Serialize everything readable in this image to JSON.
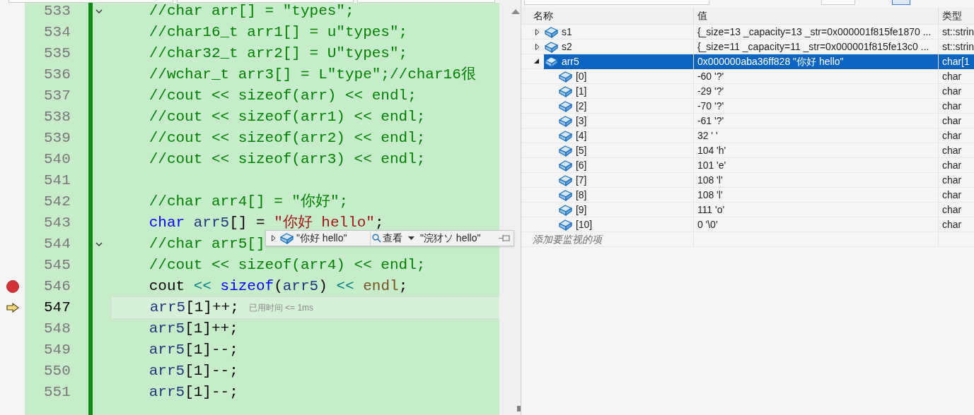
{
  "editor": {
    "lines": [
      {
        "number": "533",
        "fold": true,
        "breakpoint": false,
        "current": false,
        "segments": [
          {
            "kind": "comment",
            "text": "//char arr[] = \"types\";"
          }
        ]
      },
      {
        "number": "534",
        "fold": false,
        "breakpoint": false,
        "current": false,
        "segments": [
          {
            "kind": "comment",
            "text": "//char16_t arr1[] = u\"types\";"
          }
        ]
      },
      {
        "number": "535",
        "fold": false,
        "breakpoint": false,
        "current": false,
        "segments": [
          {
            "kind": "comment",
            "text": "//char32_t arr2[] = U\"types\";"
          }
        ]
      },
      {
        "number": "536",
        "fold": false,
        "breakpoint": false,
        "current": false,
        "segments": [
          {
            "kind": "comment",
            "text": "//wchar_t arr3[] = L\"type\";//char16很"
          }
        ]
      },
      {
        "number": "537",
        "fold": false,
        "breakpoint": false,
        "current": false,
        "segments": [
          {
            "kind": "comment",
            "text": "//cout << sizeof(arr) << endl;"
          }
        ]
      },
      {
        "number": "538",
        "fold": false,
        "breakpoint": false,
        "current": false,
        "segments": [
          {
            "kind": "comment",
            "text": "//cout << sizeof(arr1) << endl;"
          }
        ]
      },
      {
        "number": "539",
        "fold": false,
        "breakpoint": false,
        "current": false,
        "segments": [
          {
            "kind": "comment",
            "text": "//cout << sizeof(arr2) << endl;"
          }
        ]
      },
      {
        "number": "540",
        "fold": false,
        "breakpoint": false,
        "current": false,
        "segments": [
          {
            "kind": "comment",
            "text": "//cout << sizeof(arr3) << endl;"
          }
        ]
      },
      {
        "number": "541",
        "fold": false,
        "breakpoint": false,
        "current": false
      },
      {
        "number": "542",
        "fold": false,
        "breakpoint": false,
        "current": false,
        "segments": [
          {
            "kind": "comment",
            "text": "//char arr4[] = \"你好\";"
          }
        ]
      },
      {
        "number": "543",
        "fold": false,
        "breakpoint": false,
        "current": false,
        "segments": [
          {
            "kind": "keyword",
            "text": "char"
          },
          {
            "kind": "ident",
            "text": " arr5"
          },
          {
            "kind": "plain",
            "text": "[] = "
          },
          {
            "kind": "string",
            "text": "\"你好 hello\""
          },
          {
            "kind": "plain",
            "text": ";"
          }
        ]
      },
      {
        "number": "544",
        "fold": true,
        "breakpoint": false,
        "current": false,
        "segments": [
          {
            "kind": "comment",
            "text": "//char arr5[]"
          }
        ]
      },
      {
        "number": "545",
        "fold": false,
        "breakpoint": false,
        "current": false,
        "segments": [
          {
            "kind": "comment",
            "text": "//cout << sizeof(arr4) << endl;"
          }
        ]
      },
      {
        "number": "546",
        "fold": false,
        "breakpoint": true,
        "current": false,
        "segments": [
          {
            "kind": "plain",
            "text": "cout "
          },
          {
            "kind": "operator",
            "text": "<< "
          },
          {
            "kind": "keyword",
            "text": "sizeof"
          },
          {
            "kind": "plain",
            "text": "("
          },
          {
            "kind": "ident",
            "text": "arr5"
          },
          {
            "kind": "plain",
            "text": ") "
          },
          {
            "kind": "operator",
            "text": "<< "
          },
          {
            "kind": "func",
            "text": "endl"
          },
          {
            "kind": "plain",
            "text": ";"
          }
        ]
      },
      {
        "number": "547",
        "fold": false,
        "breakpoint": false,
        "current": true,
        "hint": "已用时间 <= 1ms",
        "segments": [
          {
            "kind": "ident",
            "text": "arr5"
          },
          {
            "kind": "plain",
            "text": "[1]++;"
          }
        ]
      },
      {
        "number": "548",
        "fold": false,
        "breakpoint": false,
        "current": false,
        "segments": [
          {
            "kind": "ident",
            "text": "arr5"
          },
          {
            "kind": "plain",
            "text": "[1]++;"
          }
        ]
      },
      {
        "number": "549",
        "fold": false,
        "breakpoint": false,
        "current": false,
        "segments": [
          {
            "kind": "ident",
            "text": "arr5"
          },
          {
            "kind": "plain",
            "text": "[1]--;"
          }
        ]
      },
      {
        "number": "550",
        "fold": false,
        "breakpoint": false,
        "current": false,
        "segments": [
          {
            "kind": "ident",
            "text": "arr5"
          },
          {
            "kind": "plain",
            "text": "[1]--;"
          }
        ]
      },
      {
        "number": "551",
        "fold": false,
        "breakpoint": false,
        "current": false,
        "segments": [
          {
            "kind": "ident",
            "text": "arr5"
          },
          {
            "kind": "plain",
            "text": "[1]--;"
          }
        ]
      }
    ]
  },
  "datatip": {
    "value": "\"你好 hello\"",
    "viewer": "查看",
    "visualized": "\"浣犲ソ hello\""
  },
  "watch": {
    "columns": [
      "名称",
      "值",
      "类型"
    ],
    "rows": [
      {
        "name": "s1",
        "value": "{_size=13 _capacity=13 _str=0x000001f815fe1870 ...",
        "type": "st::strin",
        "expanded": false,
        "selected": false
      },
      {
        "name": "s2",
        "value": "{_size=11 _capacity=11 _str=0x000001f815fe13c0 ...",
        "type": "st::strin",
        "expanded": false,
        "selected": false
      },
      {
        "name": "arr5",
        "value": "0x000000aba36ff828 \"你好 hello\"",
        "type": "char[1",
        "expanded": true,
        "selected": true,
        "children": [
          {
            "name": "[0]",
            "value": "-60 '?'",
            "type": "char",
            "selected": false
          },
          {
            "name": "[1]",
            "value": "-29 '?'",
            "type": "char",
            "selected": false
          },
          {
            "name": "[2]",
            "value": "-70 '?'",
            "type": "char",
            "selected": false
          },
          {
            "name": "[3]",
            "value": "-61 '?'",
            "type": "char",
            "selected": false
          },
          {
            "name": "[4]",
            "value": "32 ' '",
            "type": "char",
            "selected": false
          },
          {
            "name": "[5]",
            "value": "104 'h'",
            "type": "char",
            "selected": false
          },
          {
            "name": "[6]",
            "value": "101 'e'",
            "type": "char",
            "selected": false
          },
          {
            "name": "[7]",
            "value": "108 'l'",
            "type": "char",
            "selected": false
          },
          {
            "name": "[8]",
            "value": "108 'l'",
            "type": "char",
            "selected": false
          },
          {
            "name": "[9]",
            "value": "111 'o'",
            "type": "char",
            "selected": false
          },
          {
            "name": "[10]",
            "value": "0 '\\0'",
            "type": "char",
            "selected": false
          }
        ]
      }
    ],
    "add_placeholder": "添加要监视的项"
  }
}
